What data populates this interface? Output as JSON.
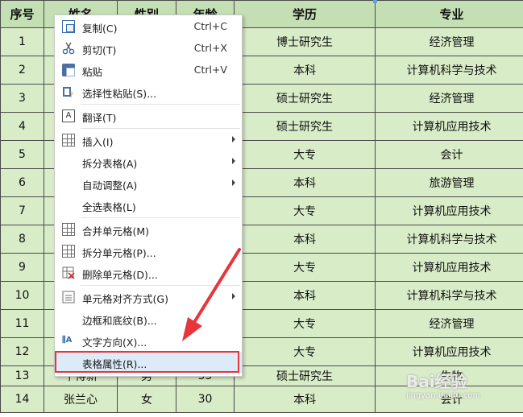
{
  "table": {
    "headers": [
      "序号",
      "姓名",
      "性别",
      "年龄",
      "学历",
      "专业"
    ],
    "rows": [
      [
        "1",
        "",
        "",
        "",
        "博士研究生",
        "经济管理"
      ],
      [
        "2",
        "",
        "",
        "",
        "本科",
        "计算机科学与技术"
      ],
      [
        "3",
        "",
        "",
        "",
        "硕士研究生",
        "经济管理"
      ],
      [
        "4",
        "",
        "",
        "",
        "硕士研究生",
        "计算机应用技术"
      ],
      [
        "5",
        "",
        "",
        "",
        "大专",
        "会计"
      ],
      [
        "6",
        "",
        "",
        "",
        "本科",
        "旅游管理"
      ],
      [
        "7",
        "",
        "",
        "",
        "大专",
        "计算机应用技术"
      ],
      [
        "8",
        "",
        "",
        "",
        "本科",
        "计算机科学与技术"
      ],
      [
        "9",
        "",
        "",
        "",
        "大专",
        "计算机应用技术"
      ],
      [
        "10",
        "",
        "",
        "",
        "本科",
        "计算机科学与技术"
      ],
      [
        "11",
        "",
        "",
        "",
        "大专",
        "经济管理"
      ],
      [
        "12",
        "",
        "",
        "",
        "大专",
        "计算机应用技术"
      ],
      [
        "13",
        "牛得新",
        "男",
        "35",
        "硕士研究生",
        "生物"
      ],
      [
        "14",
        "张兰心",
        "女",
        "30",
        "本科",
        "会计"
      ]
    ]
  },
  "context_menu": {
    "items": [
      {
        "label": "复制(C)",
        "shortcut": "Ctrl+C",
        "icon": "copy-icon"
      },
      {
        "label": "剪切(T)",
        "shortcut": "Ctrl+X",
        "icon": "scissors-icon"
      },
      {
        "label": "粘贴",
        "shortcut": "Ctrl+V",
        "icon": "paste-icon"
      },
      {
        "label": "选择性粘贴(S)...",
        "icon": "paste-special-icon"
      },
      {
        "label": "翻译(T)",
        "icon": "translate-icon"
      },
      {
        "label": "插入(I)",
        "icon": "insert-table-icon",
        "submenu": true
      },
      {
        "label": "拆分表格(A)",
        "submenu": true
      },
      {
        "label": "自动调整(A)",
        "submenu": true
      },
      {
        "label": "全选表格(L)"
      },
      {
        "label": "合并单元格(M)",
        "icon": "merge-cells-icon"
      },
      {
        "label": "拆分单元格(P)...",
        "icon": "split-cells-icon"
      },
      {
        "label": "删除单元格(D)...",
        "icon": "delete-cells-icon"
      },
      {
        "label": "单元格对齐方式(G)",
        "icon": "cell-align-icon",
        "submenu": true
      },
      {
        "label": "边框和底纹(B)..."
      },
      {
        "label": "文字方向(X)...",
        "icon": "text-direction-icon"
      },
      {
        "label": "表格属性(R)...",
        "highlighted": true
      }
    ]
  },
  "watermark": {
    "text": "Bai经验",
    "url": "jingyan.baidu.com"
  },
  "colors": {
    "header_bg": "#c5dfb4",
    "cell_bg": "#d8ecc8",
    "highlight_box": "#e8343b",
    "arrow": "#e8343b"
  }
}
